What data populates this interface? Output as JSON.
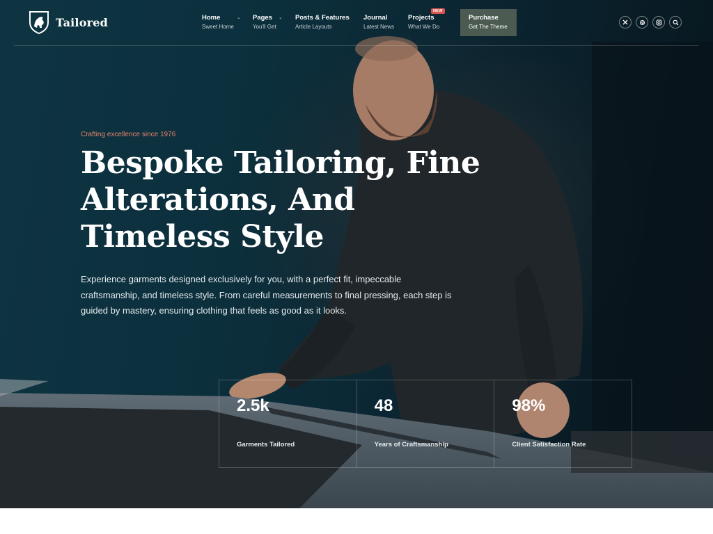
{
  "brand": {
    "name": "Tailored",
    "logo_icon": "lion-shield-icon"
  },
  "nav": {
    "items": [
      {
        "title": "Home",
        "subtitle": "Sweet Home",
        "has_dropdown": true
      },
      {
        "title": "Pages",
        "subtitle": "You'll Get",
        "has_dropdown": true
      },
      {
        "title": "Posts & Features",
        "subtitle": "Article Layouts",
        "has_dropdown": true
      },
      {
        "title": "Journal",
        "subtitle": "Latest News",
        "has_dropdown": false
      },
      {
        "title": "Projects",
        "subtitle": "What We Do",
        "has_dropdown": false,
        "badge": "NEW"
      }
    ],
    "purchase": {
      "title": "Purchase",
      "subtitle": "Get The Theme"
    }
  },
  "social": [
    "x-icon",
    "threads-icon",
    "instagram-icon",
    "search-icon"
  ],
  "hero": {
    "eyebrow": "Crafting excellence since 1976",
    "headline": "Bespoke Tailoring, Fine Alterations, And Timeless Style",
    "intro": "Experience garments designed exclusively for you, with a perfect fit, impeccable craftsmanship, and timeless style. From careful measurements to final pressing, each step is guided by mastery, ensuring clothing that feels as good as it looks."
  },
  "stats": [
    {
      "value": "2.5k",
      "label": "Garments Tailored"
    },
    {
      "value": "48",
      "label": "Years of Craftsmanship"
    },
    {
      "value": "98%",
      "label": "Client Satisfaction Rate"
    }
  ],
  "colors": {
    "accent": "#e8846c",
    "purchase_bg": "#4b5b52",
    "hero_bg": "#0c2f3c",
    "badge": "#d9534f"
  }
}
